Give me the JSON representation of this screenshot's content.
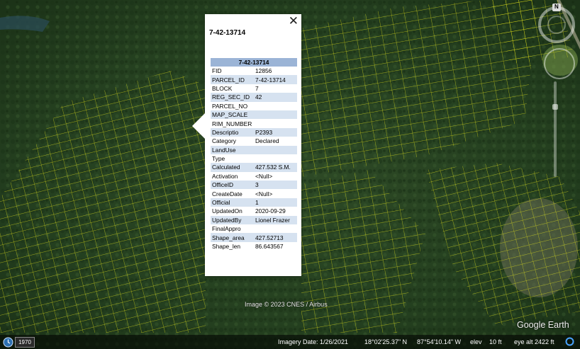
{
  "popup": {
    "title": "7-42-13714",
    "close_label": "✕",
    "table_header": "7-42-13714",
    "rows": [
      {
        "key": "FID",
        "value": "12856"
      },
      {
        "key": "PARCEL_ID",
        "value": "7-42-13714"
      },
      {
        "key": "BLOCK",
        "value": "7"
      },
      {
        "key": "REG_SEC_ID",
        "value": "42"
      },
      {
        "key": "PARCEL_NO",
        "value": ""
      },
      {
        "key": "MAP_SCALE",
        "value": ""
      },
      {
        "key": "RIM_NUMBER",
        "value": ""
      },
      {
        "key": "Descriptio",
        "value": "P2393"
      },
      {
        "key": "Category",
        "value": "Declared"
      },
      {
        "key": "LandUse",
        "value": ""
      },
      {
        "key": "Type",
        "value": ""
      },
      {
        "key": "Calculated",
        "value": "427.532 S.M."
      },
      {
        "key": "Activation",
        "value": "<Null>"
      },
      {
        "key": "OfficeID",
        "value": "3"
      },
      {
        "key": "CreateDate",
        "value": "<Null>"
      },
      {
        "key": "Official",
        "value": "1"
      },
      {
        "key": "UpdatedOn",
        "value": "2020-09-29"
      },
      {
        "key": "UpdatedBy",
        "value": "Lionel Frazer"
      },
      {
        "key": "FinalAppro",
        "value": ""
      },
      {
        "key": "Shape_area",
        "value": "427.52713"
      },
      {
        "key": "Shape_len",
        "value": "86.643567"
      }
    ]
  },
  "map": {
    "copyright": "Image © 2023 CNES / Airbus",
    "logo": "Google Earth",
    "compass_north": "N",
    "year": "1970",
    "parcel_line_color": "#e6e619",
    "forest_color": "#24401f"
  },
  "status": {
    "imagery_date": "Imagery Date: 1/26/2021",
    "lat": "18°02'25.37\" N",
    "lon": "87°54'10.14\" W",
    "elev_label": "elev",
    "elev_value": "10 ft",
    "eye_alt": "eye alt  2422 ft"
  }
}
